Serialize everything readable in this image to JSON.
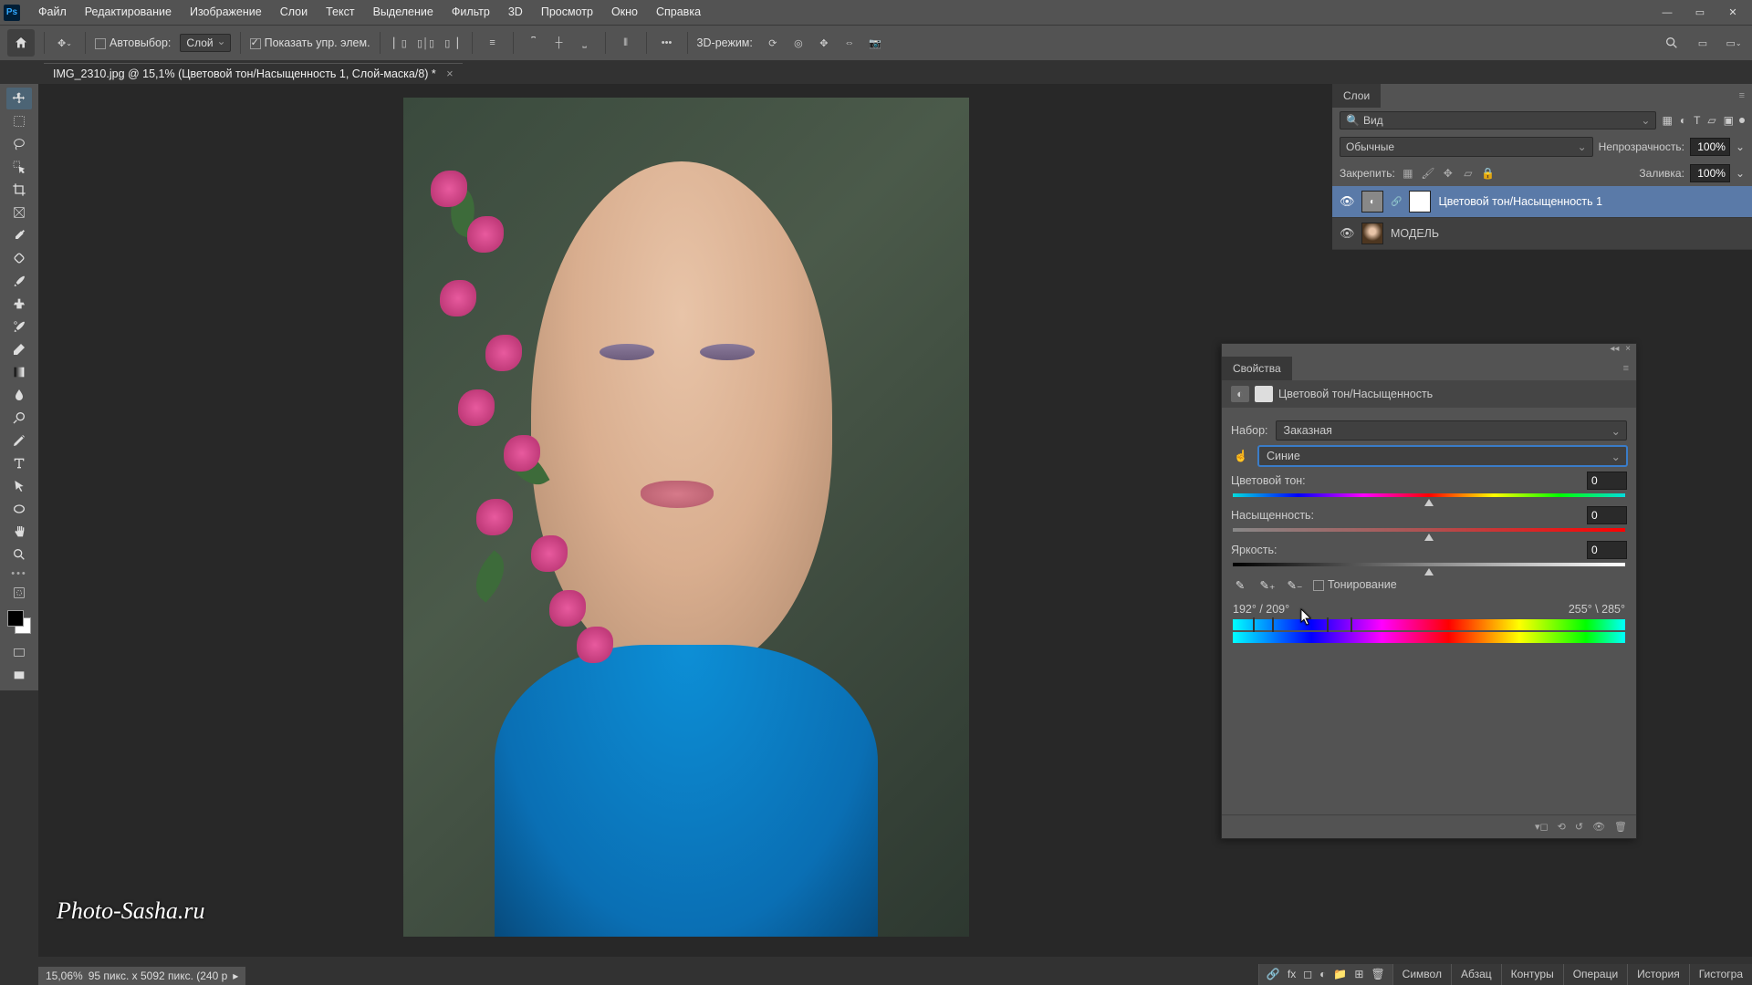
{
  "menubar": {
    "items": [
      "Файл",
      "Редактирование",
      "Изображение",
      "Слои",
      "Текст",
      "Выделение",
      "Фильтр",
      "3D",
      "Просмотр",
      "Окно",
      "Справка"
    ]
  },
  "options": {
    "auto_select_label": "Автовыбор:",
    "auto_select_value": "Слой",
    "show_controls_label": "Показать упр. элем.",
    "mode3d_label": "3D-режим:"
  },
  "tab": {
    "title": "IMG_2310.jpg @ 15,1% (Цветовой тон/Насыщенность 1, Слой-маска/8) *"
  },
  "status": {
    "zoom": "15,06%",
    "dims": "95 пикс. x 5092 пикс. (240 p"
  },
  "watermark": "Photo-Sasha.ru",
  "layers_panel": {
    "title": "Слои",
    "search_label": "Вид",
    "blend_mode": "Обычные",
    "opacity_label": "Непрозрачность:",
    "opacity_value": "100%",
    "lock_label": "Закрепить:",
    "fill_label": "Заливка:",
    "fill_value": "100%",
    "layers": [
      {
        "name": "Цветовой тон/Насыщенность 1"
      },
      {
        "name": "МОДЕЛЬ"
      }
    ]
  },
  "properties": {
    "title": "Свойства",
    "adjustment_name": "Цветовой тон/Насыщенность",
    "preset_label": "Набор:",
    "preset_value": "Заказная",
    "channel_value": "Синие",
    "hue_label": "Цветовой тон:",
    "hue_value": "0",
    "sat_label": "Насыщенность:",
    "sat_value": "0",
    "light_label": "Яркость:",
    "light_value": "0",
    "colorize_label": "Тонирование",
    "range_left": "192° / 209°",
    "range_right": "255° \\ 285°"
  },
  "bottom_tabs": [
    "Символ",
    "Абзац",
    "Контуры",
    "Операци",
    "История",
    "Гистогра"
  ]
}
